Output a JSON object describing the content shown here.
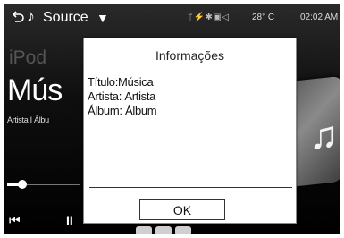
{
  "topbar": {
    "back_icon": "back-arrow-icon",
    "note_icon": "music-note-icon",
    "source_label": "Source",
    "caret": "▼",
    "status_icons": "ᛘ⚡✱▣◁",
    "temperature": "28° C",
    "clock": "02:02 AM"
  },
  "player": {
    "source_name": "iPod",
    "title": "Mús",
    "subtitle": "Artista I Álbu",
    "prev_icon": "⏮",
    "pause_icon": "II",
    "art_icon": "♫"
  },
  "dialog": {
    "title": "Informações",
    "fields": [
      {
        "label": "Título:",
        "value": "Música"
      },
      {
        "label": "Artista:",
        "value": "Artista"
      },
      {
        "label": "Álbum:",
        "value": "Álbum"
      }
    ],
    "ok_label": "OK"
  }
}
